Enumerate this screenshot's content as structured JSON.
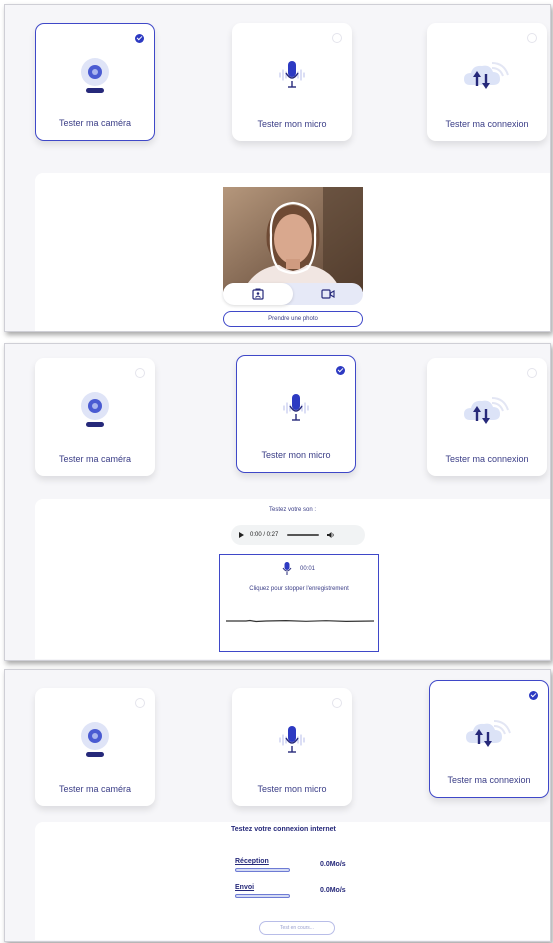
{
  "accent_color": "#2d3ac2",
  "cards": {
    "camera": "Tester ma caméra",
    "micro": "Tester mon micro",
    "connexion": "Tester ma connexion"
  },
  "camera_panel": {
    "selected": "camera",
    "modes": [
      "photo-mode-icon",
      "video-mode-icon"
    ],
    "take_photo": "Prendre une photo"
  },
  "micro_panel": {
    "selected": "micro",
    "prompt": "Testez votre son :",
    "player_time": "0:00 / 0:27",
    "rec_time": "00:01",
    "rec_hint": "Cliquez pour stopper l'enregistrement"
  },
  "connexion_panel": {
    "selected": "connexion",
    "title": "Testez votre connexion internet",
    "reception_label": "Réception",
    "reception_value": "0.0Mo/s",
    "envoi_label": "Envoi",
    "envoi_value": "0.0Mo/s",
    "status_button": "Test en cours..."
  }
}
